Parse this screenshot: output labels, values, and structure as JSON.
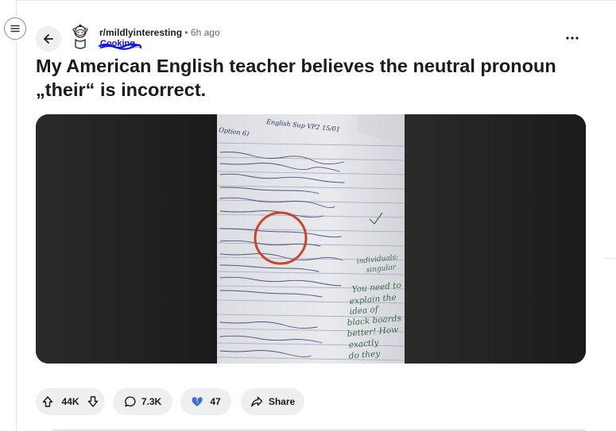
{
  "post": {
    "subreddit": "r/mildlyinteresting",
    "separator": "•",
    "time_ago": "6h ago",
    "author": "Cooking_",
    "title": "My American English teacher believes the neutral pronoun „their“ is incorrect."
  },
  "actions": {
    "votes": "44K",
    "comments": "7.3K",
    "awards": "47",
    "share": "Share"
  },
  "colors": {
    "pill_bg": "#edeff1",
    "author_scribble": "#1212e8",
    "ink_circle": "#c9442b",
    "green_ink": "#3a6b44"
  },
  "icons": {
    "menu": "hamburger-icon",
    "back": "arrow-left-icon",
    "more": "ellipsis-icon",
    "upvote": "arrow-up-icon",
    "downvote": "arrow-down-icon",
    "comment": "speech-bubble-icon",
    "award": "broken-heart-icon",
    "share": "share-arrow-icon"
  },
  "image_text": {
    "header": "English Sup VP2 15/01",
    "section": "Option 6)",
    "margin_notes": [
      "individuals:",
      "singular"
    ],
    "teacher_notes": [
      "You need to",
      "explain the",
      "idea of",
      "black boards",
      "better! How",
      "exactly",
      "do they"
    ]
  }
}
